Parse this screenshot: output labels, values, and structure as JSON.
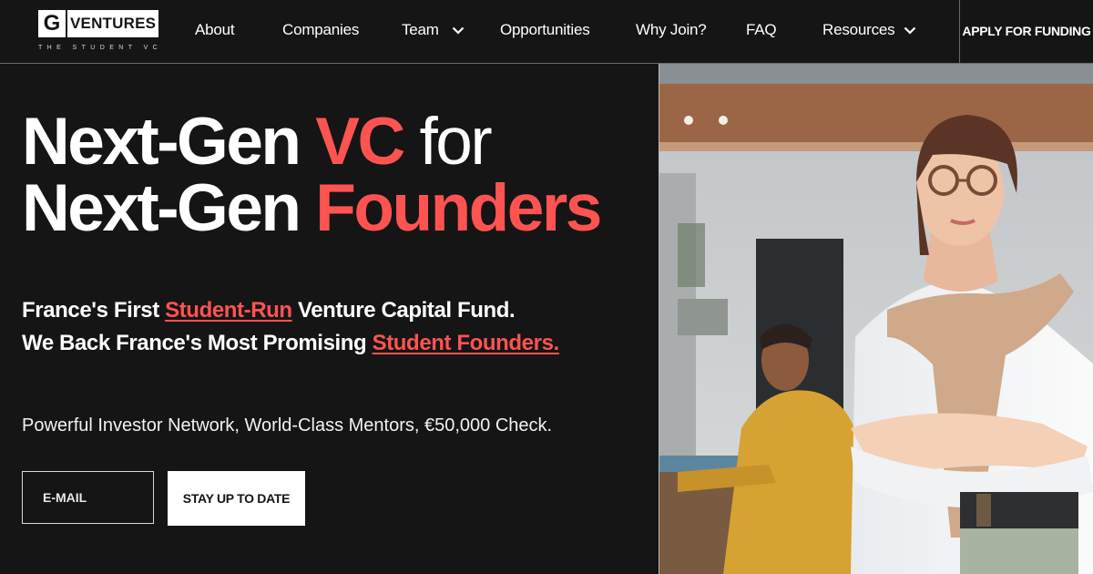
{
  "brand": {
    "logo_mark": "G",
    "logo_word": "VENTURES",
    "logo_sub": "THE STUDENT VC"
  },
  "nav": {
    "items": [
      {
        "label": "About"
      },
      {
        "label": "Companies"
      },
      {
        "label": "Team",
        "icon": "chevron-down-icon"
      },
      {
        "label": "Opportunities"
      },
      {
        "label": "Why Join?"
      },
      {
        "label": "FAQ"
      },
      {
        "label": "Resources",
        "icon": "chevron-down-icon"
      }
    ],
    "cta": "APPLY FOR FUNDING"
  },
  "hero": {
    "line1_a": "Next-Gen ",
    "line1_b": "VC",
    "line1_c": " for",
    "line2_a": "Next-Gen ",
    "line2_b": "Founders",
    "tagline1_a": "France's First ",
    "tagline1_link": "Student-Run",
    "tagline1_c": " Venture Capital Fund.",
    "tagline2_a": "We Back France's Most Promising ",
    "tagline2_link": "Student Founders.",
    "perks": "Powerful Investor Network, World-Class Mentors, €50,000 Check."
  },
  "signup": {
    "email_placeholder": "E-MAIL",
    "button": "STAY UP TO DATE"
  },
  "colors": {
    "accent": "#ff5352",
    "background": "#151515"
  }
}
